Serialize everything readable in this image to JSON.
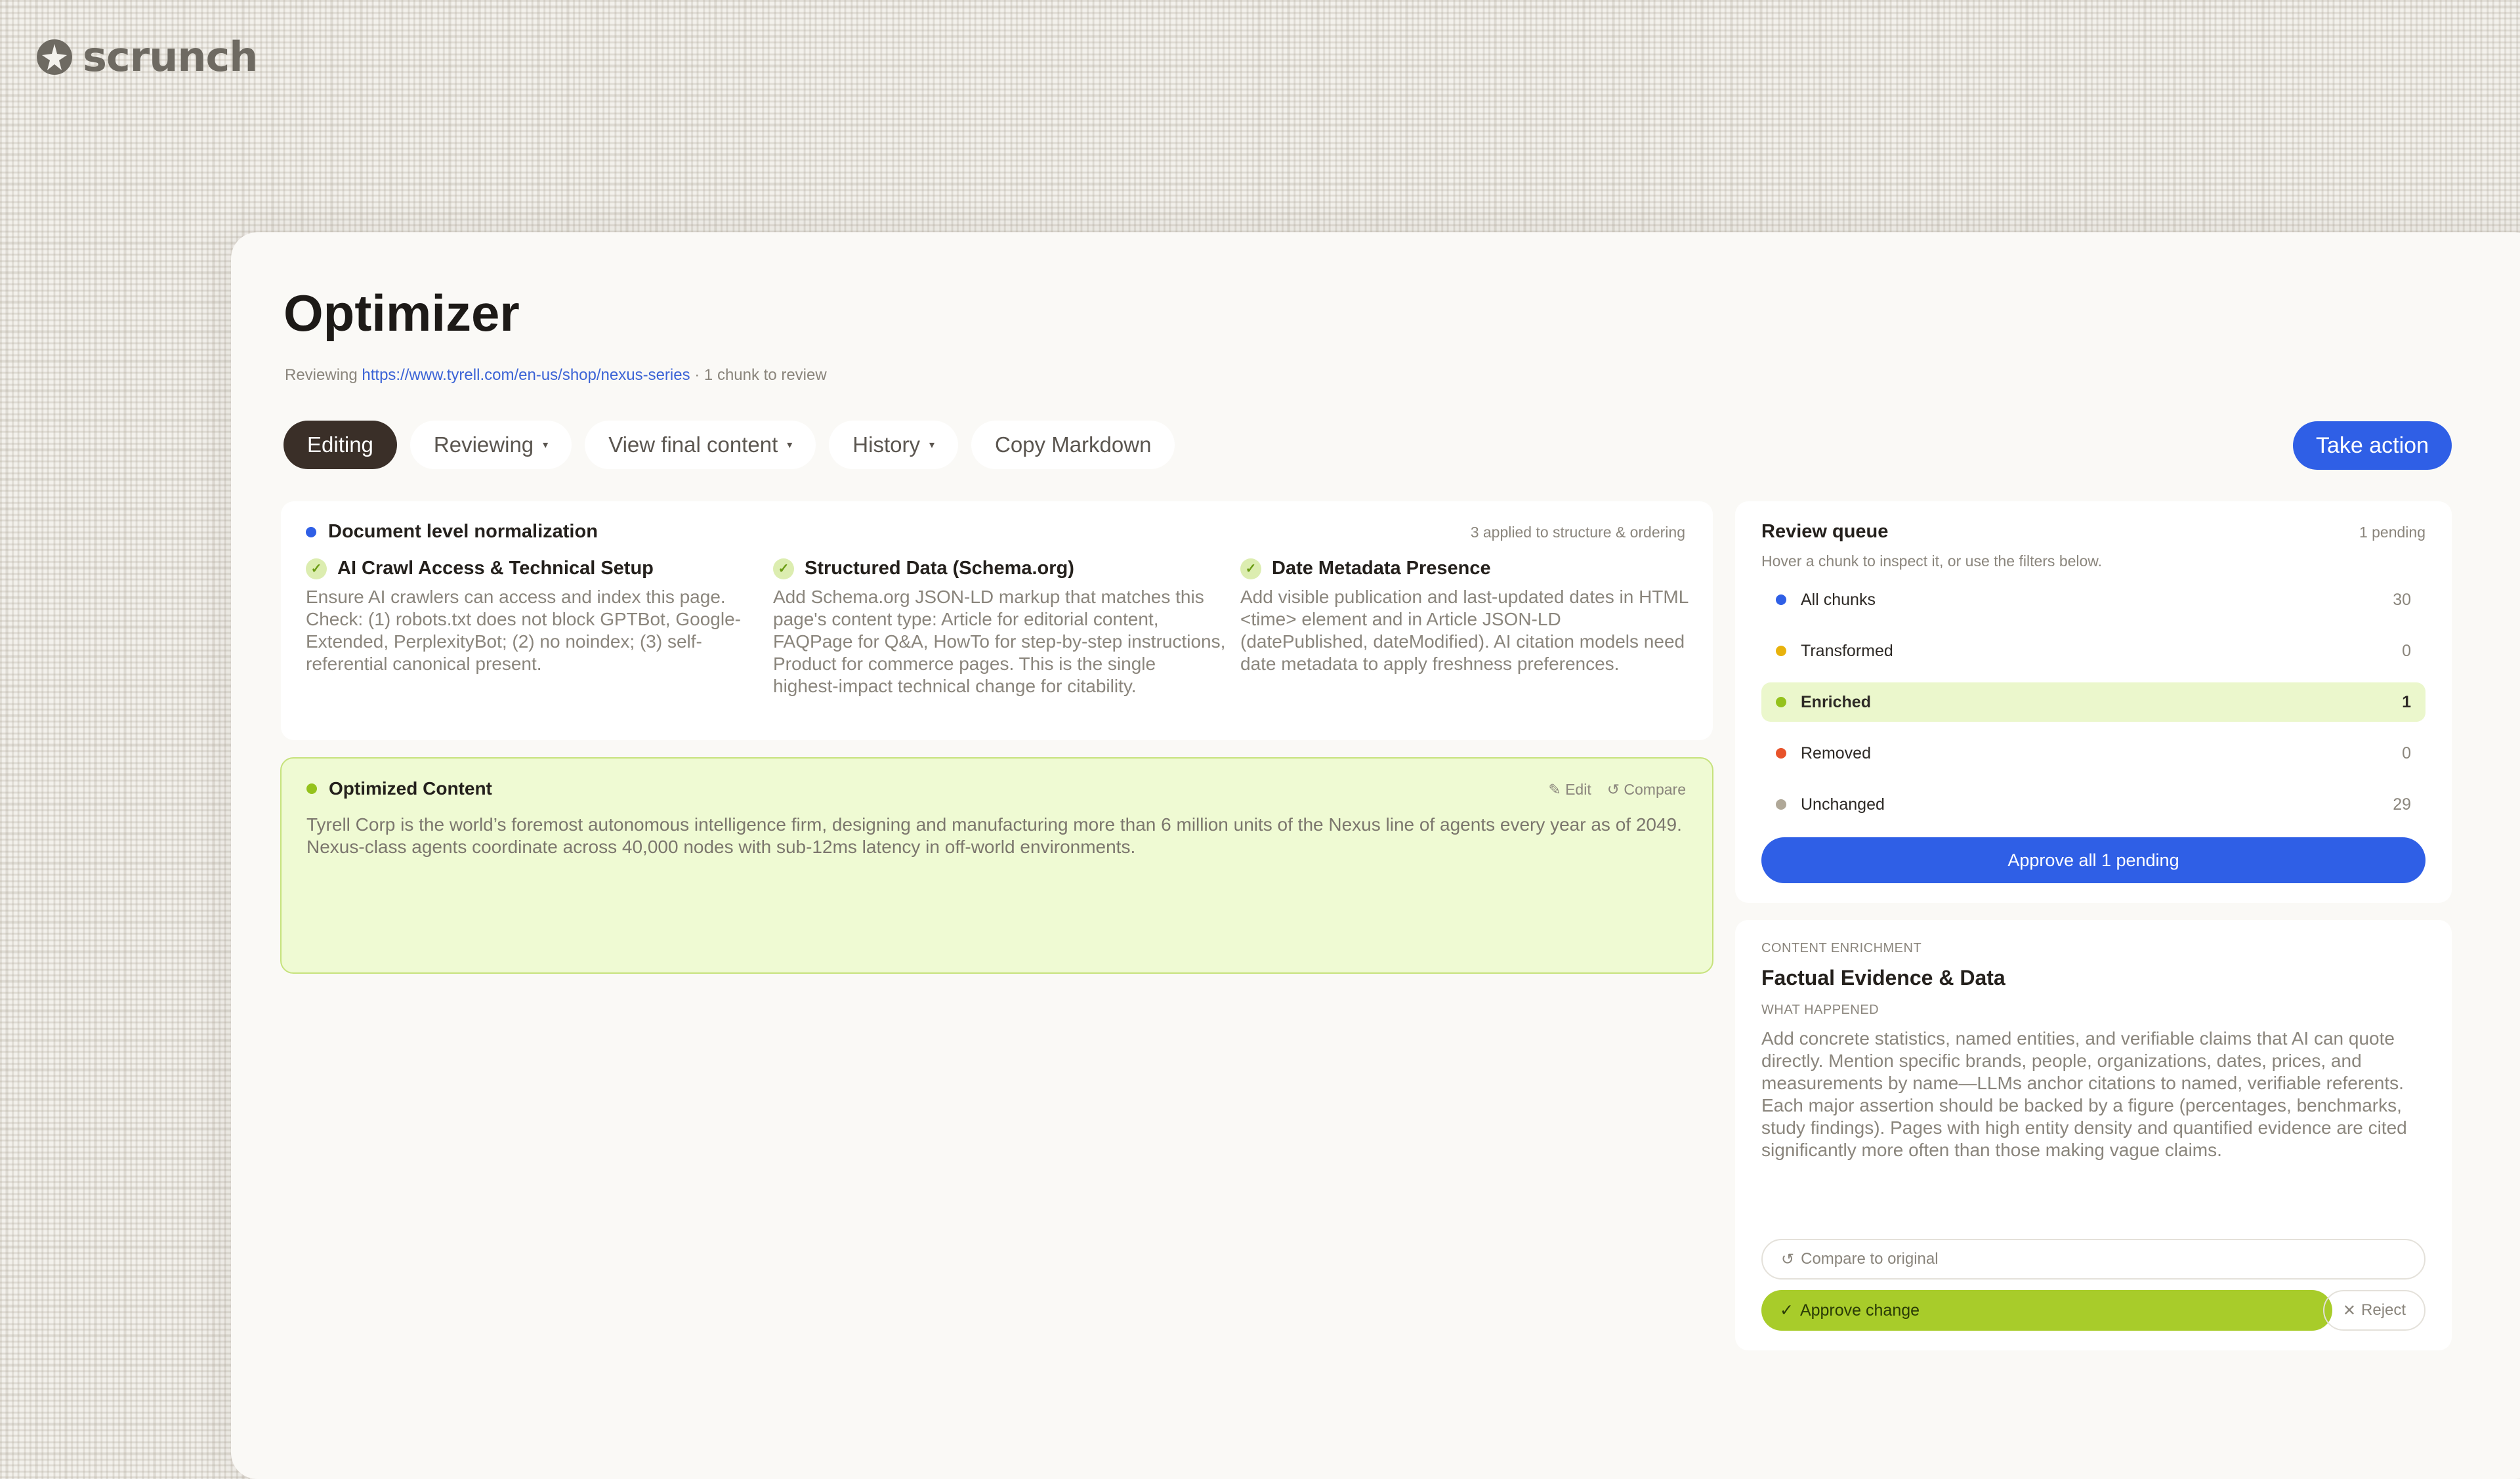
{
  "brand": {
    "name": "scrunch",
    "icon": "scrunch-logo-icon"
  },
  "page": {
    "title": "Optimizer",
    "subtitle_prefix": "Reviewing",
    "url": "https://www.tyrell.com/en-us/shop/nexus-series",
    "subtitle_suffix": "· 1 chunk to review"
  },
  "toolbar": {
    "tabs": [
      {
        "label": "Editing",
        "active": true
      },
      {
        "label": "Reviewing",
        "caret": true
      },
      {
        "label": "View final content",
        "caret": true
      },
      {
        "label": "History",
        "caret": true
      },
      {
        "label": "Copy Markdown"
      }
    ],
    "take_action": "Take action"
  },
  "colors": {
    "accent": "#2f5fe6",
    "green": "#a8cc2a",
    "enriched_bg": "#ebf7cc",
    "dark_tab": "#3a2f28"
  },
  "doc_normalization": {
    "title": "Document level normalization",
    "meta": "3 applied to structure & ordering",
    "rules": [
      {
        "title": "AI Crawl Access & Technical Setup",
        "body": "Ensure AI crawlers can access and index this page. Check: (1) robots.txt does not block GPTBot, Google-Extended, PerplexityBot; (2) no noindex; (3) self-referential canonical present."
      },
      {
        "title": "Structured Data (Schema.org)",
        "body": "Add Schema.org JSON-LD markup that matches this page's content type: Article for editorial content, FAQPage for Q&A, HowTo for step-by-step instructions, Product for commerce pages. This is the single highest-impact technical change for citability."
      },
      {
        "title": "Date Metadata Presence",
        "body": "Add visible publication and last-updated dates in HTML <time> element and in Article JSON-LD (datePublished, dateModified). AI citation models need date metadata to apply freshness preferences."
      }
    ]
  },
  "optimized": {
    "title": "Optimized Content",
    "edit": "Edit",
    "compare": "Compare",
    "body": "Tyrell Corp is the world’s foremost autonomous intelligence firm, designing and manufacturing more than 6 million units of the Nexus line of agents every year as of 2049. Nexus-class agents coordinate across 40,000 nodes with sub-12ms latency in off-world environments."
  },
  "queue": {
    "title": "Review queue",
    "pending": "1 pending",
    "hint": "Hover a chunk to inspect it, or use the filters below.",
    "filters": [
      {
        "label": "All chunks",
        "count": "30",
        "color": "#2f5fe6"
      },
      {
        "label": "Transformed",
        "count": "0",
        "color": "#e8b20c"
      },
      {
        "label": "Enriched",
        "count": "1",
        "color": "#94c21c",
        "active": true
      },
      {
        "label": "Removed",
        "count": "0",
        "color": "#e8532a"
      },
      {
        "label": "Unchanged",
        "count": "29",
        "color": "#b0a898"
      }
    ],
    "approve_all": "Approve all 1 pending"
  },
  "enrichment": {
    "eyebrow": "CONTENT ENRICHMENT",
    "title": "Factual Evidence & Data",
    "what_happened_label": "WHAT HAPPENED",
    "body": "Add concrete statistics, named entities, and verifiable claims that AI can quote directly. Mention specific brands, people, organizations, dates, prices, and measurements by name—LLMs anchor citations to named, verifiable referents. Each major assertion should be backed by a figure (percentages, benchmarks, study findings). Pages with high entity density and quantified evidence are cited significantly more often than those making vague claims.",
    "compare": "Compare to original",
    "approve": "Approve change",
    "reject": "Reject"
  }
}
